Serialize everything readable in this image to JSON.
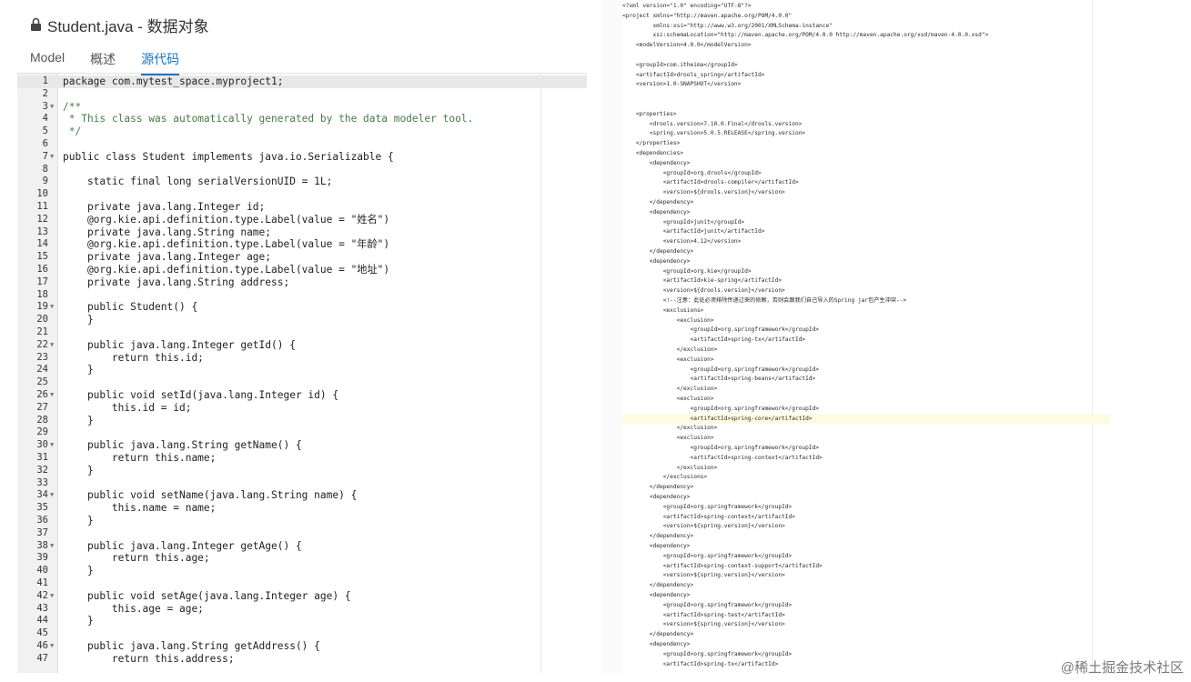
{
  "left_panel": {
    "title": "Student.java - 数据对象",
    "tabs": [
      "Model",
      "概述",
      "源代码"
    ],
    "active_tab": 2,
    "code_lines": [
      {
        "n": "1",
        "fold": false,
        "text": "package com.mytest_space.myproject1;"
      },
      {
        "n": "2",
        "fold": false,
        "text": ""
      },
      {
        "n": "3",
        "fold": true,
        "text": "/**"
      },
      {
        "n": "4",
        "fold": false,
        "text": " * This class was automatically generated by the data modeler tool."
      },
      {
        "n": "5",
        "fold": false,
        "text": " */"
      },
      {
        "n": "6",
        "fold": false,
        "text": ""
      },
      {
        "n": "7",
        "fold": true,
        "text": "public class Student implements java.io.Serializable {"
      },
      {
        "n": "8",
        "fold": false,
        "text": ""
      },
      {
        "n": "9",
        "fold": false,
        "text": "    static final long serialVersionUID = 1L;"
      },
      {
        "n": "10",
        "fold": false,
        "text": ""
      },
      {
        "n": "11",
        "fold": false,
        "text": "    private java.lang.Integer id;"
      },
      {
        "n": "12",
        "fold": false,
        "text": "    @org.kie.api.definition.type.Label(value = \"姓名\")"
      },
      {
        "n": "13",
        "fold": false,
        "text": "    private java.lang.String name;"
      },
      {
        "n": "14",
        "fold": false,
        "text": "    @org.kie.api.definition.type.Label(value = \"年龄\")"
      },
      {
        "n": "15",
        "fold": false,
        "text": "    private java.lang.Integer age;"
      },
      {
        "n": "16",
        "fold": false,
        "text": "    @org.kie.api.definition.type.Label(value = \"地址\")"
      },
      {
        "n": "17",
        "fold": false,
        "text": "    private java.lang.String address;"
      },
      {
        "n": "18",
        "fold": false,
        "text": ""
      },
      {
        "n": "19",
        "fold": true,
        "text": "    public Student() {"
      },
      {
        "n": "20",
        "fold": false,
        "text": "    }"
      },
      {
        "n": "21",
        "fold": false,
        "text": ""
      },
      {
        "n": "22",
        "fold": true,
        "text": "    public java.lang.Integer getId() {"
      },
      {
        "n": "23",
        "fold": false,
        "text": "        return this.id;"
      },
      {
        "n": "24",
        "fold": false,
        "text": "    }"
      },
      {
        "n": "25",
        "fold": false,
        "text": ""
      },
      {
        "n": "26",
        "fold": true,
        "text": "    public void setId(java.lang.Integer id) {"
      },
      {
        "n": "27",
        "fold": false,
        "text": "        this.id = id;"
      },
      {
        "n": "28",
        "fold": false,
        "text": "    }"
      },
      {
        "n": "29",
        "fold": false,
        "text": ""
      },
      {
        "n": "30",
        "fold": true,
        "text": "    public java.lang.String getName() {"
      },
      {
        "n": "31",
        "fold": false,
        "text": "        return this.name;"
      },
      {
        "n": "32",
        "fold": false,
        "text": "    }"
      },
      {
        "n": "33",
        "fold": false,
        "text": ""
      },
      {
        "n": "34",
        "fold": true,
        "text": "    public void setName(java.lang.String name) {"
      },
      {
        "n": "35",
        "fold": false,
        "text": "        this.name = name;"
      },
      {
        "n": "36",
        "fold": false,
        "text": "    }"
      },
      {
        "n": "37",
        "fold": false,
        "text": ""
      },
      {
        "n": "38",
        "fold": true,
        "text": "    public java.lang.Integer getAge() {"
      },
      {
        "n": "39",
        "fold": false,
        "text": "        return this.age;"
      },
      {
        "n": "40",
        "fold": false,
        "text": "    }"
      },
      {
        "n": "41",
        "fold": false,
        "text": ""
      },
      {
        "n": "42",
        "fold": true,
        "text": "    public void setAge(java.lang.Integer age) {"
      },
      {
        "n": "43",
        "fold": false,
        "text": "        this.age = age;"
      },
      {
        "n": "44",
        "fold": false,
        "text": "    }"
      },
      {
        "n": "45",
        "fold": false,
        "text": ""
      },
      {
        "n": "46",
        "fold": true,
        "text": "    public java.lang.String getAddress() {"
      },
      {
        "n": "47",
        "fold": false,
        "text": "        return this.address;"
      }
    ]
  },
  "right_panel": {
    "xml_lines": [
      "<?xml version=\"1.0\" encoding=\"UTF-8\"?>",
      "<project xmlns=\"http://maven.apache.org/POM/4.0.0\"",
      "         xmlns:xsi=\"http://www.w3.org/2001/XMLSchema-instance\"",
      "         xsi:schemaLocation=\"http://maven.apache.org/POM/4.0.0 http://maven.apache.org/xsd/maven-4.0.0.xsd\">",
      "    <modelVersion>4.0.0</modelVersion>",
      "",
      "    <groupId>com.itheima</groupId>",
      "    <artifactId>drools_spring</artifactId>",
      "    <version>1.0-SNAPSHOT</version>",
      "",
      "",
      "    <properties>",
      "        <drools.version>7.10.0.Final</drools.version>",
      "        <spring.version>5.0.5.RELEASE</spring.version>",
      "    </properties>",
      "    <dependencies>",
      "        <dependency>",
      "            <groupId>org.drools</groupId>",
      "            <artifactId>drools-compiler</artifactId>",
      "            <version>${drools.version}</version>",
      "        </dependency>",
      "        <dependency>",
      "            <groupId>junit</groupId>",
      "            <artifactId>junit</artifactId>",
      "            <version>4.12</version>",
      "        </dependency>",
      "        <dependency>",
      "            <groupId>org.kie</groupId>",
      "            <artifactId>kie-spring</artifactId>",
      "            <version>${drools.version}</version>",
      "            <!--注意：此处必须排除传递过来的依赖，否则会跟我们自己导入的Spring jar包产生冲突-->",
      "            <exclusions>",
      "                <exclusion>",
      "                    <groupId>org.springframework</groupId>",
      "                    <artifactId>spring-tx</artifactId>",
      "                </exclusion>",
      "                <exclusion>",
      "                    <groupId>org.springframework</groupId>",
      "                    <artifactId>spring-beans</artifactId>",
      "                </exclusion>",
      "                <exclusion>",
      "                    <groupId>org.springframework</groupId>",
      "                    <artifactId>spring-core</artifactId>",
      "                </exclusion>",
      "                <exclusion>",
      "                    <groupId>org.springframework</groupId>",
      "                    <artifactId>spring-context</artifactId>",
      "                </exclusion>",
      "            </exclusions>",
      "        </dependency>",
      "        <dependency>",
      "            <groupId>org.springframework</groupId>",
      "            <artifactId>spring-context</artifactId>",
      "            <version>${spring.version}</version>",
      "        </dependency>",
      "        <dependency>",
      "            <groupId>org.springframework</groupId>",
      "            <artifactId>spring-context-support</artifactId>",
      "            <version>${spring.version}</version>",
      "        </dependency>",
      "        <dependency>",
      "            <groupId>org.springframework</groupId>",
      "            <artifactId>spring-test</artifactId>",
      "            <version>${spring.version}</version>",
      "        </dependency>",
      "        <dependency>",
      "            <groupId>org.springframework</groupId>",
      "            <artifactId>spring-tx</artifactId>"
    ],
    "highlight_line": 42
  },
  "watermark": "@稀土掘金技术社区"
}
